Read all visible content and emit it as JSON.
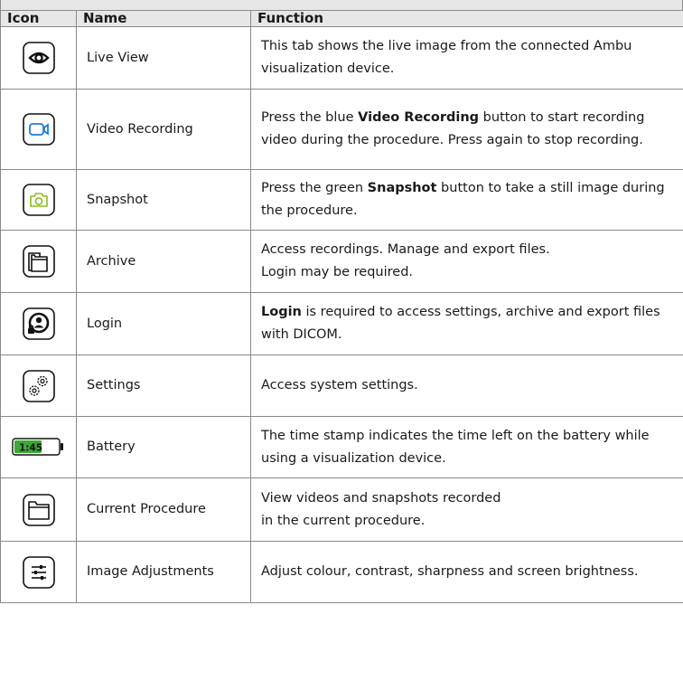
{
  "table": {
    "headers": {
      "icon": "Icon",
      "name": "Name",
      "function": "Function"
    },
    "rows": [
      {
        "icon": "eye-icon",
        "name": "Live View",
        "function": {
          "pre": "This tab shows the live image from the connected Ambu visualization device.",
          "bold": "",
          "post": ""
        }
      },
      {
        "icon": "video-camera-icon",
        "name": "Video Recording",
        "function": {
          "pre": "Press the blue ",
          "bold": "Video Recording",
          "post": " button to start recording video during the procedure. Press again to stop recording."
        }
      },
      {
        "icon": "camera-icon",
        "name": "Snapshot",
        "function": {
          "pre": "Press the green ",
          "bold": "Snapshot",
          "post": " button to take a still image during the procedure."
        }
      },
      {
        "icon": "archive-folders-icon",
        "name": "Archive",
        "function": {
          "pre": "Access recordings. Manage and export files.",
          "bold": "",
          "post": "",
          "line2": "Login may be required."
        }
      },
      {
        "icon": "user-lock-icon",
        "name": "Login",
        "function": {
          "pre": "",
          "bold": "Login",
          "post": " is required to access settings, archive and export files with DICOM."
        }
      },
      {
        "icon": "gears-icon",
        "name": "Settings",
        "function": {
          "pre": "Access system settings.",
          "bold": "",
          "post": ""
        }
      },
      {
        "icon": "battery-icon",
        "name": "Battery",
        "icon_text": "1:45",
        "function": {
          "pre": "The time stamp indicates the time left on the battery while using a visualization device.",
          "bold": "",
          "post": ""
        }
      },
      {
        "icon": "folder-icon",
        "name": "Current Procedure",
        "function": {
          "pre": "View videos and snapshots recorded",
          "bold": "",
          "post": "",
          "line2": "in the current procedure."
        }
      },
      {
        "icon": "sliders-icon",
        "name": "Image Adjustments",
        "function": {
          "pre": "Adjust colour, contrast, sharpness and screen brightness.",
          "bold": "",
          "post": ""
        }
      }
    ]
  },
  "colors": {
    "video_blue": "#1e7fd6",
    "snapshot_green": "#8dbb1c",
    "battery_green": "#3aa935",
    "header_bg": "#e7e7e7",
    "border": "#8a8a8a"
  }
}
